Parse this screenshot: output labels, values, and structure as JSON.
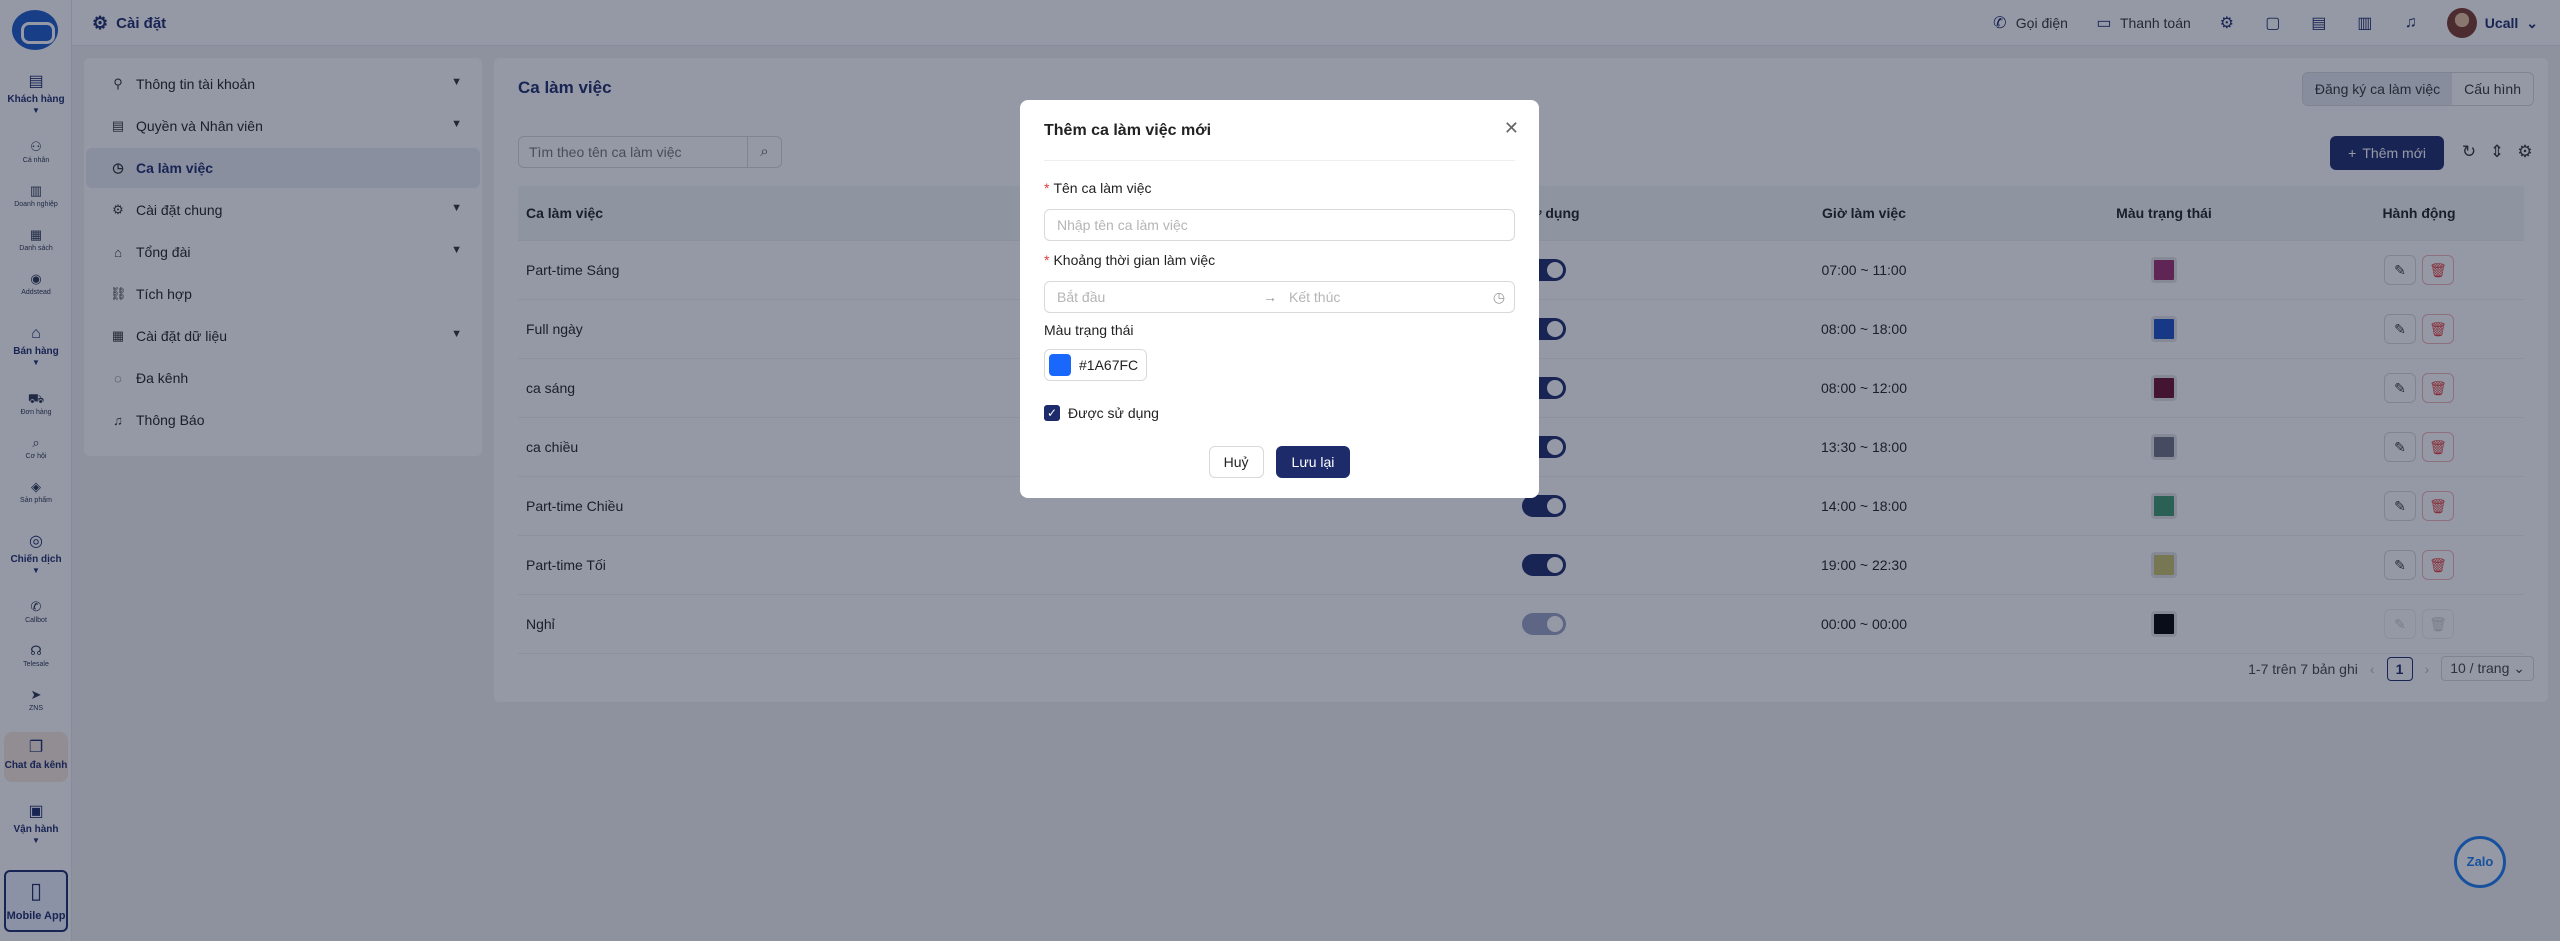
{
  "rail": {
    "groups": [
      {
        "label": "Khách hàng",
        "items": [
          "Cá nhân",
          "Doanh nghiệp",
          "Danh sách",
          "Addstead"
        ]
      },
      {
        "label": "Bán hàng",
        "items": [
          "Đơn hàng",
          "Cơ hội",
          "Sản phẩm"
        ]
      },
      {
        "label": "Chiến dịch",
        "items": [
          "Callbot",
          "Telesale",
          "ZNS"
        ]
      },
      {
        "label": "Chat đa kênh"
      },
      {
        "label": "Vận hành"
      }
    ],
    "mobile_label": "Mobile App"
  },
  "topbar": {
    "title": "Cài đặt",
    "call_label": "Gọi điện",
    "billing_label": "Thanh toán",
    "user_name": "Ucall"
  },
  "menu": {
    "items": [
      {
        "label": "Thông tin tài khoản"
      },
      {
        "label": "Quyền và Nhân viên"
      },
      {
        "label": "Ca làm việc"
      },
      {
        "label": "Cài đặt chung"
      },
      {
        "label": "Tổng đài"
      },
      {
        "label": "Tích hợp"
      },
      {
        "label": "Cài đặt dữ liệu"
      },
      {
        "label": "Đa kênh"
      },
      {
        "label": "Thông Báo"
      }
    ]
  },
  "panel": {
    "title": "Ca làm việc",
    "seg_register": "Đăng ký ca làm việc",
    "seg_config": "Cấu hình",
    "search_placeholder": "Tìm theo tên ca làm việc",
    "add_label": "Thêm mới",
    "columns": {
      "name": "Ca làm việc",
      "used": "Sử dụng",
      "hours": "Giờ làm việc",
      "color": "Màu trạng thái",
      "actions": "Hành động"
    },
    "rows": [
      {
        "name": "Part-time Sáng",
        "hours": "07:00 ~ 11:00",
        "color": "#9b2c6e",
        "enabled": true
      },
      {
        "name": "Full ngày",
        "hours": "08:00 ~ 18:00",
        "color": "#1a4fc4",
        "enabled": true
      },
      {
        "name": "ca sáng",
        "hours": "08:00 ~ 12:00",
        "color": "#6b0f2e",
        "enabled": true
      },
      {
        "name": "ca chiều",
        "hours": "13:30 ~ 18:00",
        "color": "#6d7384",
        "enabled": true
      },
      {
        "name": "Part-time Chiều",
        "hours": "14:00 ~ 18:00",
        "color": "#3c9a6c",
        "enabled": true
      },
      {
        "name": "Part-time Tối",
        "hours": "19:00 ~ 22:30",
        "color": "#c9c46a",
        "enabled": true
      },
      {
        "name": "Nghỉ",
        "hours": "00:00 ~ 00:00",
        "color": "#000000",
        "enabled": true,
        "locked": true
      }
    ],
    "pagination": {
      "summary": "1-7 trên 7 bản ghi",
      "page": "1",
      "page_size": "10 / trang"
    }
  },
  "modal": {
    "title": "Thêm ca làm việc mới",
    "name_label": "Tên ca làm việc",
    "name_placeholder": "Nhập tên ca làm việc",
    "time_label": "Khoảng thời gian làm việc",
    "start_placeholder": "Bắt đầu",
    "end_placeholder": "Kết thúc",
    "color_label": "Màu trạng thái",
    "color_value": "#1A67FC",
    "enabled_label": "Được sử dụng",
    "enabled": true,
    "cancel_label": "Huỷ",
    "save_label": "Lưu lại"
  },
  "zalo_label": "Zalo"
}
